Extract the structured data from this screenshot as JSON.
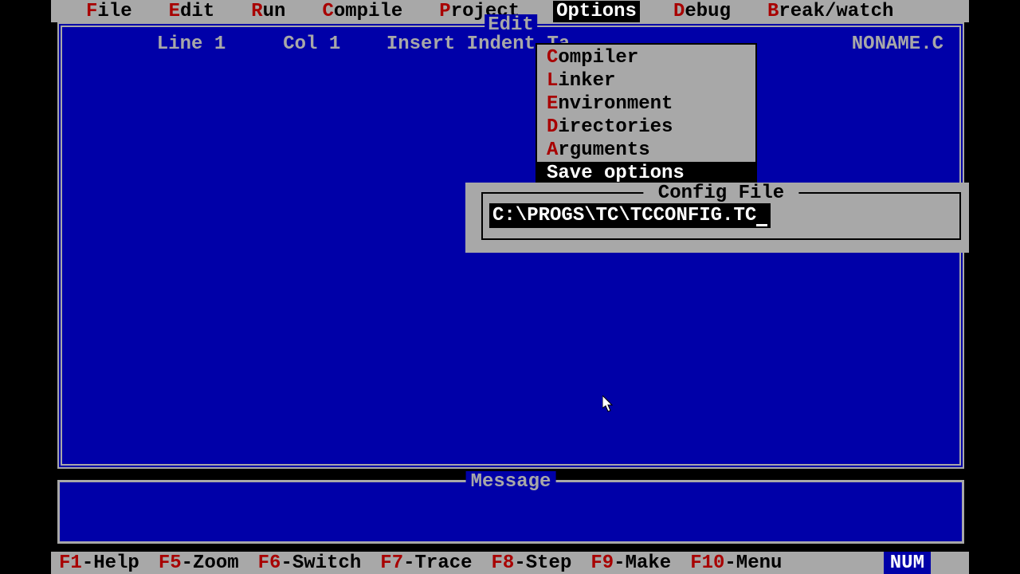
{
  "menubar": {
    "items": [
      {
        "hot": "F",
        "rest": "ile"
      },
      {
        "hot": "E",
        "rest": "dit"
      },
      {
        "hot": "R",
        "rest": "un"
      },
      {
        "hot": "C",
        "rest": "ompile"
      },
      {
        "hot": "P",
        "rest": "roject"
      },
      {
        "hot": "O",
        "rest": "ptions"
      },
      {
        "hot": "D",
        "rest": "ebug"
      },
      {
        "hot": "B",
        "rest": "reak/watch"
      }
    ],
    "selected_index": 5
  },
  "editor": {
    "title": "Edit",
    "status": "  Line 1     Col 1    Insert Indent Ta",
    "filename": "NONAME.C"
  },
  "options_menu": {
    "items": [
      {
        "hot": "C",
        "rest": "ompiler"
      },
      {
        "hot": "L",
        "rest": "inker"
      },
      {
        "hot": "E",
        "rest": "nvironment"
      },
      {
        "hot": "D",
        "rest": "irectories"
      },
      {
        "hot": "A",
        "rest": "rguments"
      },
      {
        "hot": "S",
        "rest": "ave options"
      }
    ],
    "selected_index": 5
  },
  "dialog": {
    "title": " Config File ",
    "value": "C:\\PROGS\\TC\\TCCONFIG.TC"
  },
  "message": {
    "title": "Message"
  },
  "bottombar": {
    "keys": [
      {
        "hot": "F1",
        "rest": "-Help"
      },
      {
        "hot": "F5",
        "rest": "-Zoom"
      },
      {
        "hot": "F6",
        "rest": "-Switch"
      },
      {
        "hot": "F7",
        "rest": "-Trace"
      },
      {
        "hot": "F8",
        "rest": "-Step"
      },
      {
        "hot": "F9",
        "rest": "-Make"
      },
      {
        "hot": "F10",
        "rest": "-Menu"
      }
    ],
    "indicator": "NUM"
  }
}
